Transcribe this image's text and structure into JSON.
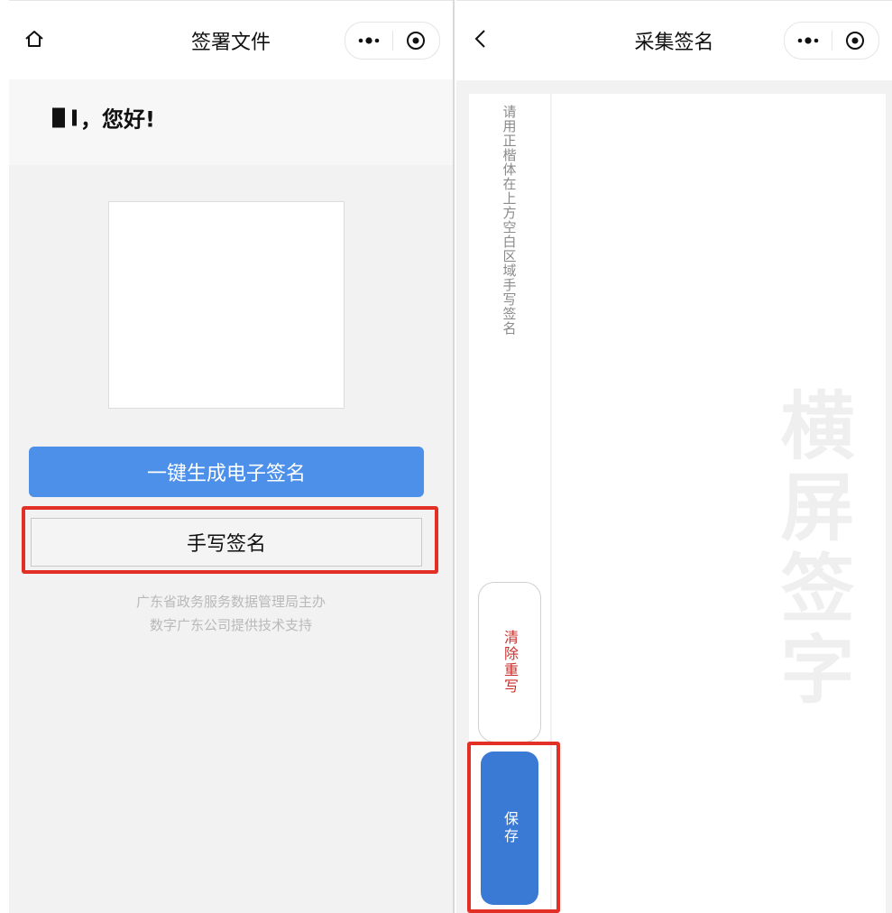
{
  "left": {
    "nav": {
      "title": "签署文件",
      "home_icon": "home-icon",
      "more_icon": "more-icon",
      "close_icon": "close-target-icon"
    },
    "greeting": "，您好!",
    "buttons": {
      "generate_label": "一键生成电子签名",
      "handwrite_label": "手写签名"
    },
    "footer": {
      "line1": "广东省政务服务数据管理局主办",
      "line2": "数字广东公司提供技术支持"
    }
  },
  "right": {
    "nav": {
      "title": "采集签名",
      "back_icon": "back-chevron-icon",
      "more_icon": "more-icon",
      "close_icon": "close-target-icon"
    },
    "hint": "请用正楷体在上方空白区域手写签名",
    "watermark": "横屏签字",
    "buttons": {
      "clear_label": "清除重写",
      "save_label": "保存"
    }
  },
  "colors": {
    "primary": "#4d90ea",
    "save": "#3a79d4",
    "highlight": "#e33027",
    "clear_text": "#c9302c"
  }
}
